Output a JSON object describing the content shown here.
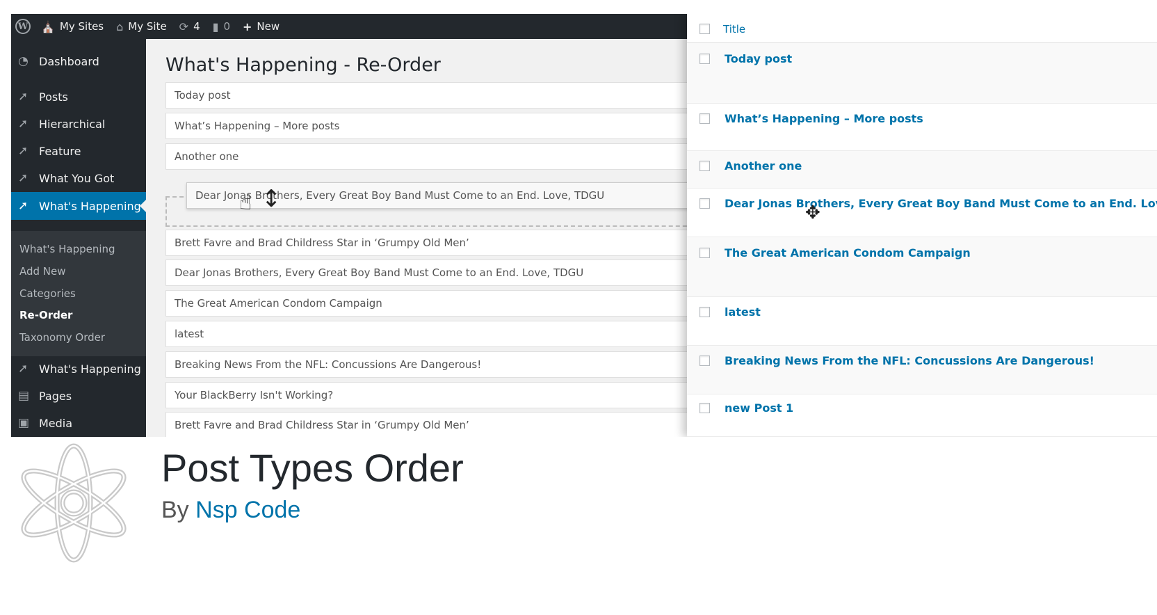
{
  "admin_bar": {
    "my_sites": "My Sites",
    "my_site": "My Site",
    "updates_count": "4",
    "comments_count": "0",
    "new_label": "New"
  },
  "sidebar": {
    "items": [
      {
        "label": "Dashboard",
        "icon": "dashboard-icon"
      },
      {
        "label": "Posts",
        "icon": "pin-icon"
      },
      {
        "label": "Hierarchical",
        "icon": "pin-icon"
      },
      {
        "label": "Feature",
        "icon": "pin-icon"
      },
      {
        "label": "What You Got",
        "icon": "pin-icon"
      },
      {
        "label": "What's Happening",
        "icon": "pin-icon"
      },
      {
        "label": "What's Happening",
        "icon": "pin-icon"
      },
      {
        "label": "Pages",
        "icon": "pages-icon"
      },
      {
        "label": "Media",
        "icon": "media-icon"
      }
    ],
    "submenu": [
      "What's Happening",
      "Add New",
      "Categories",
      "Re-Order",
      "Taxonomy Order"
    ],
    "accent": "#0073aa"
  },
  "reorder": {
    "heading": "What's Happening - Re-Order",
    "rows": [
      "Today post",
      "What’s Happening – More posts",
      "Another one",
      "Brett Favre and Brad Childress Star in ‘Grumpy Old Men’",
      "Dear Jonas Brothers, Every Great Boy Band Must Come to an End. Love, TDGU",
      "The Great American Condom Campaign",
      "latest",
      "Breaking News From the NFL: Concussions Are Dangerous!",
      "Your BlackBerry Isn't Working?",
      "Brett Favre and Brad Childress Star in ‘Grumpy Old Men’"
    ],
    "dragged": "Dear Jonas Brothers, Every Great Boy Band Must Come to an End. Love, TDGU"
  },
  "posts_list": {
    "header_title": "Title",
    "rows": [
      "Today post",
      "What’s Happening – More posts",
      "Another one",
      "Dear Jonas Brothers, Every Great Boy Band Must Come to an End. Love, TDGU",
      "The Great American Condom Campaign",
      "latest",
      "Breaking News From the NFL: Concussions Are Dangerous!",
      "new Post 1"
    ]
  },
  "plugin": {
    "title": "Post Types Order",
    "by": "By",
    "author": "Nsp Code"
  }
}
